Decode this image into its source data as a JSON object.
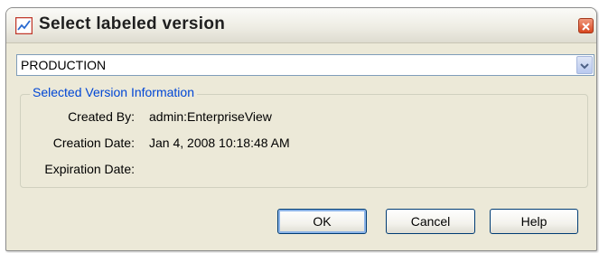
{
  "window": {
    "title": "Select labeled version",
    "icon": "chart-line-icon",
    "close_icon": "close-icon"
  },
  "version_select": {
    "selected_value": "PRODUCTION",
    "arrow_icon": "chevron-down-icon"
  },
  "info_group": {
    "legend": "Selected Version Information",
    "rows": [
      {
        "label": "Created By:",
        "value": "admin:EnterpriseView"
      },
      {
        "label": "Creation Date:",
        "value": "Jan 4, 2008 10:18:48 AM"
      },
      {
        "label": "Expiration Date:",
        "value": ""
      }
    ]
  },
  "buttons": {
    "ok": "OK",
    "cancel": "Cancel",
    "help": "Help"
  },
  "colors": {
    "dialog_background": "#ece9d8",
    "legend_text": "#0046d5",
    "close_button": "#d8461e",
    "combo_border": "#7f9db9"
  }
}
